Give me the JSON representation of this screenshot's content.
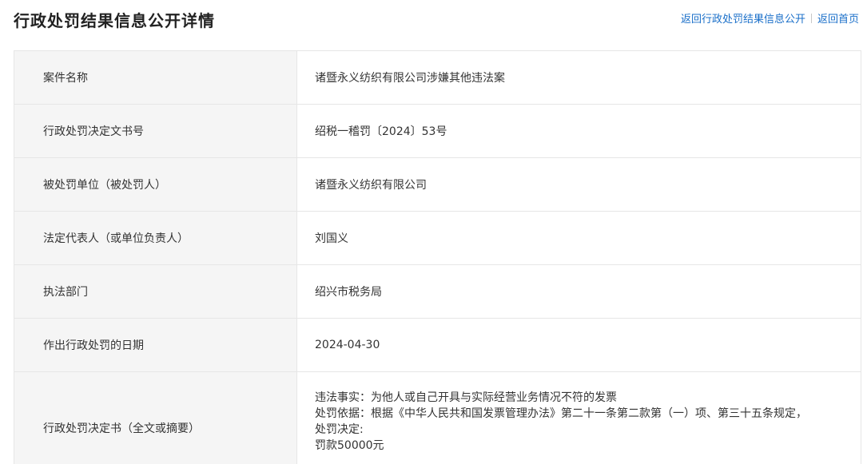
{
  "header": {
    "title": "行政处罚结果信息公开详情",
    "link_back_list": "返回行政处罚结果信息公开",
    "link_home": "返回首页"
  },
  "rows": [
    {
      "label": "案件名称",
      "value": "诸暨永义纺织有限公司涉嫌其他违法案"
    },
    {
      "label": "行政处罚决定文书号",
      "value": "绍税一稽罚〔2024〕53号"
    },
    {
      "label": "被处罚单位（被处罚人）",
      "value": "诸暨永义纺织有限公司"
    },
    {
      "label": "法定代表人（或单位负责人）",
      "value": "刘国义"
    },
    {
      "label": "执法部门",
      "value": "绍兴市税务局"
    },
    {
      "label": "作出行政处罚的日期",
      "value": "2024-04-30"
    },
    {
      "label": "行政处罚决定书（全文或摘要）",
      "lines": [
        "违法事实：为他人或自己开具与实际经营业务情况不符的发票",
        "处罚依据：根据《中华人民共和国发票管理办法》第二十一条第二款第（一）项、第三十五条规定，",
        "处罚决定:",
        "罚款50000元"
      ]
    }
  ],
  "colors": {
    "link": "#1a6fc9",
    "label_bg": "#f5f5f5",
    "border": "#e6e6e6",
    "text": "#333333"
  }
}
